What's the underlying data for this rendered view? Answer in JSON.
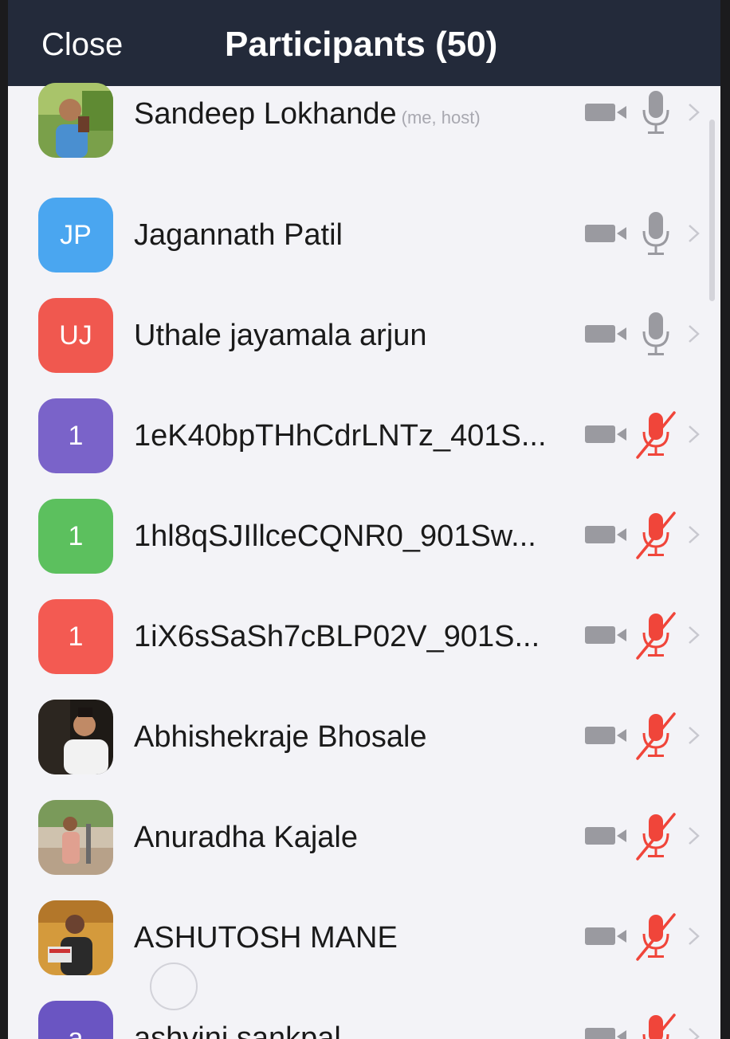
{
  "header": {
    "close_label": "Close",
    "title": "Participants (50)"
  },
  "colors": {
    "topbar": "#232a3a",
    "background": "#f3f3f7",
    "icon_gray": "#9a9aa0",
    "muted_red": "#f0453a"
  },
  "participants": [
    {
      "name": "Sandeep Lokhande",
      "tag": "(me, host)",
      "avatar": "photo",
      "mic": "on"
    },
    {
      "name": "Jagannath Patil",
      "initials": "JP",
      "avatar_color": "#4aa6f0",
      "mic": "on"
    },
    {
      "name": "Uthale jayamala arjun",
      "initials": "UJ",
      "avatar_color": "#f0584f",
      "mic": "on"
    },
    {
      "name": "1eK40bpTHhCdrLNTz_401S...",
      "initials": "1",
      "avatar_color": "#7a63c9",
      "mic": "muted"
    },
    {
      "name": "1hl8qSJIllceCQNR0_901Sw...",
      "initials": "1",
      "avatar_color": "#5cc05e",
      "mic": "muted"
    },
    {
      "name": "1iX6sSaSh7cBLP02V_901S...",
      "initials": "1",
      "avatar_color": "#f35a52",
      "mic": "muted"
    },
    {
      "name": "Abhishekraje Bhosale",
      "avatar": "photo",
      "mic": "muted"
    },
    {
      "name": "Anuradha Kajale",
      "avatar": "photo",
      "mic": "muted"
    },
    {
      "name": "ASHUTOSH MANE",
      "avatar": "photo",
      "mic": "muted"
    },
    {
      "name": "ashvini sankpal",
      "initials": "a",
      "avatar_color": "#6a55c2",
      "mic": "muted"
    }
  ]
}
